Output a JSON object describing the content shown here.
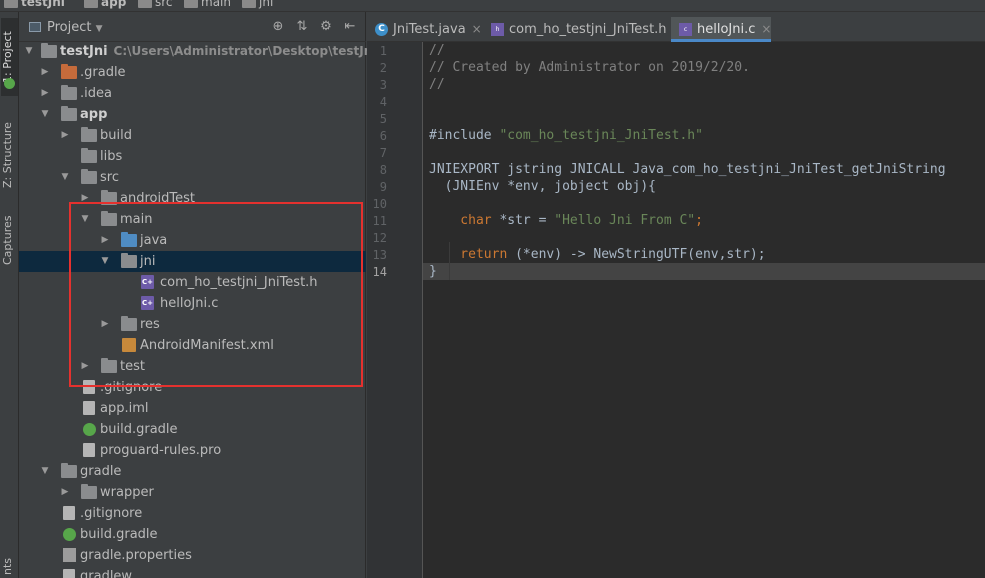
{
  "breadcrumb": {
    "items": [
      "testJni",
      "app",
      "src",
      "main",
      "jni"
    ]
  },
  "tool_stripe": {
    "tabs": [
      "1: Project",
      "Z: Structure",
      "Captures",
      "nts"
    ]
  },
  "project_panel": {
    "title": "Project",
    "tools": [
      "⊕",
      "⇅",
      "⚙",
      "⇤"
    ],
    "tree": [
      {
        "label": "testJni",
        "path": "C:\\Users\\Administrator\\Desktop\\testJni"
      },
      {
        "label": ".gradle"
      },
      {
        "label": ".idea"
      },
      {
        "label": "app"
      },
      {
        "label": "build"
      },
      {
        "label": "libs"
      },
      {
        "label": "src"
      },
      {
        "label": "androidTest"
      },
      {
        "label": "main"
      },
      {
        "label": "java"
      },
      {
        "label": "jni"
      },
      {
        "label": "com_ho_testjni_JniTest.h"
      },
      {
        "label": "helloJni.c"
      },
      {
        "label": "res"
      },
      {
        "label": "AndroidManifest.xml"
      },
      {
        "label": "test"
      },
      {
        "label": ".gitignore"
      },
      {
        "label": "app.iml"
      },
      {
        "label": "build.gradle"
      },
      {
        "label": "proguard-rules.pro"
      },
      {
        "label": "gradle"
      },
      {
        "label": "wrapper"
      },
      {
        "label": ".gitignore"
      },
      {
        "label": "build.gradle"
      },
      {
        "label": "gradle.properties"
      },
      {
        "label": "gradlew"
      }
    ]
  },
  "editor": {
    "tabs": [
      {
        "label": "JniTest.java",
        "icon": "C"
      },
      {
        "label": "com_ho_testjni_JniTest.h",
        "icon": "h"
      },
      {
        "label": "helloJni.c",
        "icon": "c"
      }
    ],
    "close_glyph": "×",
    "line_numbers": [
      "1",
      "2",
      "3",
      "4",
      "5",
      "6",
      "7",
      "8",
      "9",
      "10",
      "11",
      "12",
      "13",
      "14"
    ],
    "lines": {
      "l1": "//",
      "l2": "// Created by Administrator on 2019/2/20.",
      "l3": "//",
      "l6_kw": "#include ",
      "l6_str": "\"com_ho_testjni_JniTest.h\"",
      "l8": "JNIEXPORT jstring JNICALL Java_com_ho_testjni_JniTest_getJniString",
      "l9a": "  (JNIEnv ",
      "l9b": "*env",
      "l9c": ", jobject obj){",
      "l11_kw": "    char ",
      "l11_var": "*str",
      "l11_eq": " = ",
      "l11_str": "\"Hello Jni From C\"",
      "l11_end": ";",
      "l13_kw": "    return ",
      "l13_a": "(",
      "l13_b": "*env",
      "l13_c": ") -> NewStringUTF(env,str);",
      "l14": "}"
    }
  }
}
